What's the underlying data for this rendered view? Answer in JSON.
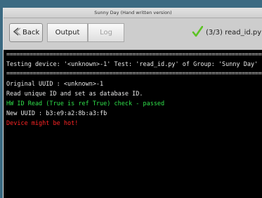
{
  "window": {
    "title": "Sunny Day (Hand written version)"
  },
  "toolbar": {
    "back_label": "Back",
    "tabs": [
      {
        "label": "Output",
        "state": "active"
      },
      {
        "label": "Log",
        "state": "disabled"
      }
    ],
    "status_text": "(3/3) read_id.py",
    "status_icon": "check-icon"
  },
  "terminal": {
    "separator": "===================================================================================",
    "header": "Testing device: '<unknown>-1' Test: 'read_id.py' of Group: 'Sunny Day'",
    "lines": [
      {
        "text": "Original UUID : <unknown>-1",
        "kind": "normal"
      },
      {
        "text": "Read unique ID and set as database ID.",
        "kind": "normal"
      },
      {
        "text": "HW ID Read (True is ref True) check - passed",
        "kind": "pass"
      },
      {
        "text": "New UUID : b3:e9:a2:8b:a3:fb",
        "kind": "normal"
      },
      {
        "text": "Device might be hot!",
        "kind": "warning"
      }
    ]
  },
  "colors": {
    "pass": "#2fe04a",
    "warning": "#ff2525",
    "check": "#5cc324"
  }
}
